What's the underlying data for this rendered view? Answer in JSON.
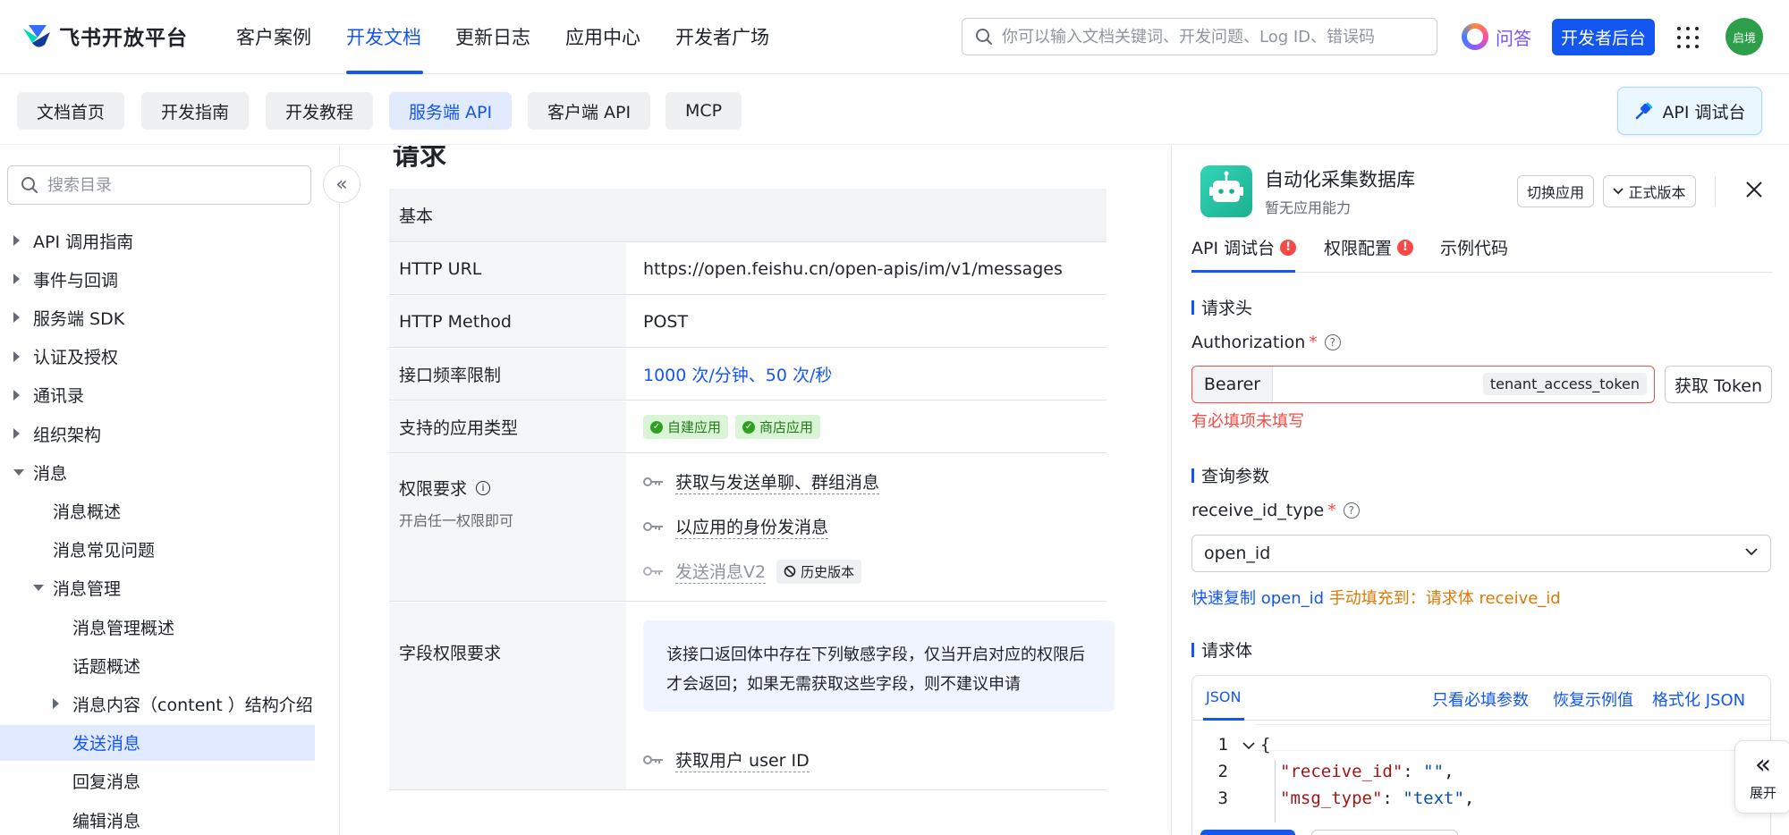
{
  "topnav": {
    "logo_text": "飞书开放平台",
    "items": [
      "客户案例",
      "开发文档",
      "更新日志",
      "应用中心",
      "开发者广场"
    ],
    "active_item": "开发文档",
    "search_placeholder": "你可以输入文档关键词、开发问题、Log ID、错误码",
    "qa_label": "问答",
    "dev_console_label": "开发者后台",
    "avatar_text": "启境"
  },
  "subnav": {
    "chips": [
      "文档首页",
      "开发指南",
      "开发教程",
      "服务端 API",
      "客户端 API",
      "MCP"
    ],
    "active_chip": "服务端 API",
    "api_console_label": "API 调试台"
  },
  "sidebar": {
    "search_placeholder": "搜索目录",
    "items": [
      {
        "label": "API 调用指南",
        "level": 0,
        "caret": "right"
      },
      {
        "label": "事件与回调",
        "level": 0,
        "caret": "right"
      },
      {
        "label": "服务端 SDK",
        "level": 0,
        "caret": "right"
      },
      {
        "label": "认证及授权",
        "level": 0,
        "caret": "right"
      },
      {
        "label": "通讯录",
        "level": 0,
        "caret": "right"
      },
      {
        "label": "组织架构",
        "level": 0,
        "caret": "right"
      },
      {
        "label": "消息",
        "level": 0,
        "caret": "down"
      },
      {
        "label": "消息概述",
        "level": 1,
        "caret": ""
      },
      {
        "label": "消息常见问题",
        "level": 1,
        "caret": ""
      },
      {
        "label": "消息管理",
        "level": 1,
        "caret": "down"
      },
      {
        "label": "消息管理概述",
        "level": 2,
        "caret": ""
      },
      {
        "label": "话题概述",
        "level": 2,
        "caret": ""
      },
      {
        "label": "消息内容（content ）结构介绍",
        "level": 2,
        "caret": "right"
      },
      {
        "label": "发送消息",
        "level": 2,
        "caret": "",
        "selected": true
      },
      {
        "label": "回复消息",
        "level": 2,
        "caret": ""
      },
      {
        "label": "编辑消息",
        "level": 2,
        "caret": ""
      }
    ]
  },
  "main": {
    "heading_fragment": "请求",
    "table_header": "基本",
    "http_url_label": "HTTP URL",
    "http_url": "https://open.feishu.cn/open-apis/im/v1/messages",
    "http_method_label": "HTTP Method",
    "http_method": "POST",
    "rate_limit_label": "接口频率限制",
    "rate_limit": "1000 次/分钟、50 次/秒",
    "app_types_label": "支持的应用类型",
    "app_types": [
      "自建应用",
      "商店应用"
    ],
    "perm_label": "权限要求",
    "perm_sub": "开启任一权限即可",
    "permissions": [
      "获取与发送单聊、群组消息",
      "以应用的身份发消息",
      "发送消息V2"
    ],
    "history_tag": "历史版本",
    "field_perm_label": "字段权限要求",
    "field_notice": "该接口返回体中存在下列敏感字段，仅当开启对应的权限后才会返回；如果无需获取这些字段，则不建议申请",
    "field_perm": "获取用户 user ID"
  },
  "rpanel": {
    "app_name": "自动化采集数据库",
    "app_sub": "暂无应用能力",
    "switch_app": "切换应用",
    "version": "正式版本",
    "tabs": [
      "API 调试台",
      "权限配置",
      "示例代码"
    ],
    "section_headers": "请求头",
    "auth_label": "Authorization",
    "bearer": "Bearer",
    "token_type": "tenant_access_token",
    "get_token": "获取 Token",
    "required_error": "有必填项未填写",
    "section_query": "查询参数",
    "receive_id_type_label": "receive_id_type",
    "receive_id_type_value": "open_id",
    "quick_copy": "快速复制 open_id",
    "quick_fill": "手动填充到：请求体 receive_id",
    "section_body": "请求体",
    "editor_tab": "JSON",
    "editor_actions": [
      "只看必填参数",
      "恢复示例值",
      "格式化 JSON"
    ],
    "code": [
      {
        "n": "1",
        "text": "{"
      },
      {
        "n": "2",
        "key": "\"receive_id\"",
        "val": "\"\""
      },
      {
        "n": "3",
        "key": "\"msg_type\"",
        "val": "\"text\""
      }
    ]
  },
  "expand_label": "展开",
  "colors": {
    "brand": "#1456f0",
    "error": "#f54a45",
    "success": "#2ea121",
    "warn_orange": "#de7802"
  }
}
